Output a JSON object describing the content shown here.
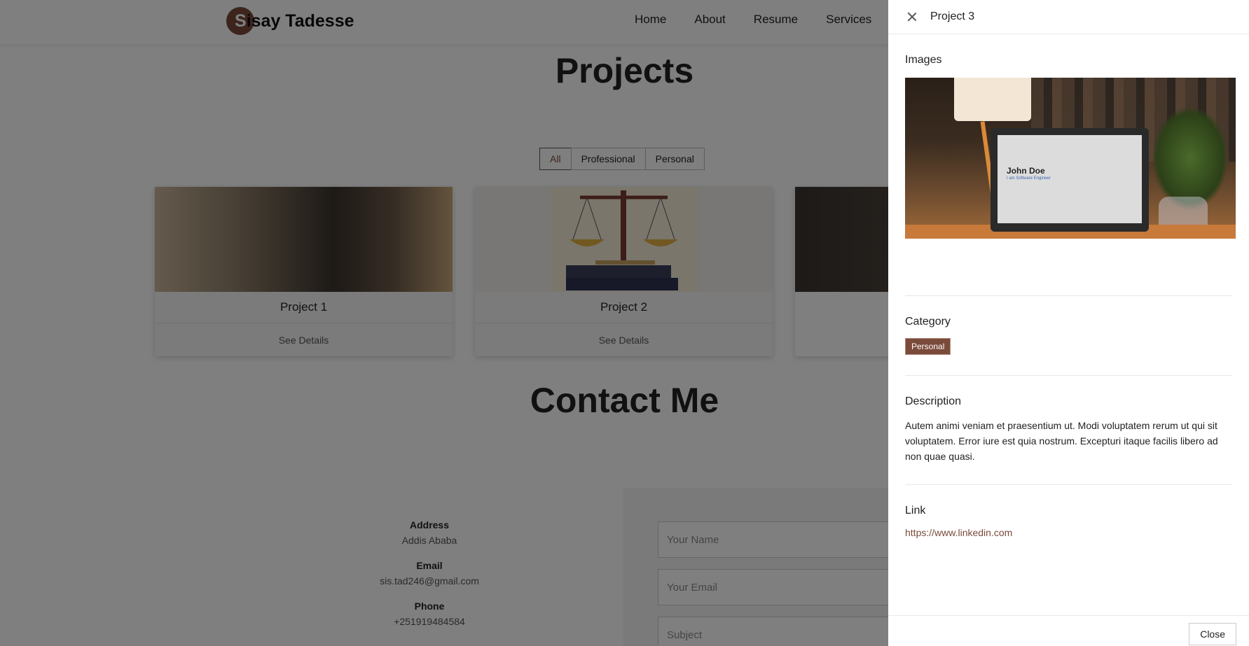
{
  "header": {
    "brand_initial": "S",
    "brand_rest": "isay Tadesse",
    "nav": [
      "Home",
      "About",
      "Resume",
      "Services"
    ]
  },
  "projects": {
    "title": "Projects",
    "filters": [
      "All",
      "Professional",
      "Personal"
    ],
    "active_filter": "All",
    "cards": [
      {
        "title": "Project 1",
        "link": "See Details"
      },
      {
        "title": "Project 2",
        "link": "See Details"
      }
    ]
  },
  "contact": {
    "title": "Contact Me",
    "info": [
      {
        "label": "Address",
        "value": "Addis Ababa"
      },
      {
        "label": "Email",
        "value": "sis.tad246@gmail.com"
      },
      {
        "label": "Phone",
        "value": "+251919484584"
      }
    ],
    "form": {
      "name_placeholder": "Your Name",
      "email_placeholder": "Your Email",
      "subject_placeholder": "Subject"
    }
  },
  "drawer": {
    "title": "Project 3",
    "images_heading": "Images",
    "screenshot_name": "John Doe",
    "screenshot_sub": "I am Software Engineer",
    "category_heading": "Category",
    "category_badge": "Personal",
    "description_heading": "Description",
    "description": "Autem animi veniam et praesentium ut. Modi voluptatem rerum ut qui sit voluptatem. Error iure est quia nostrum. Excepturi itaque facilis libero ad non quae quasi.",
    "link_heading": "Link",
    "link": "https://www.linkedin.com",
    "close_label": "Close"
  },
  "colors": {
    "accent": "#7a4a3a",
    "backdrop": "rgba(0,0,0,0.5)"
  }
}
